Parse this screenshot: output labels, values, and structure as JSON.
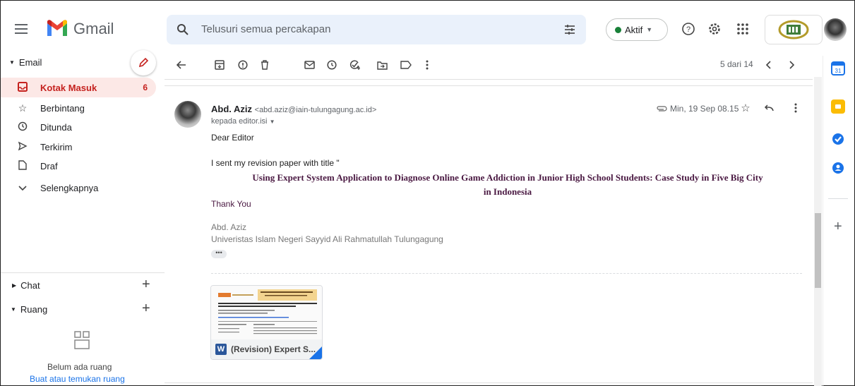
{
  "header": {
    "app_name": "Gmail",
    "search_placeholder": "Telusuri semua percakapan",
    "status": "Aktif"
  },
  "sidebar": {
    "email_header": "Email",
    "items": [
      {
        "label": "Kotak Masuk",
        "count": "6",
        "icon": "inbox-icon"
      },
      {
        "label": "Berbintang",
        "icon": "star-icon"
      },
      {
        "label": "Ditunda",
        "icon": "clock-icon"
      },
      {
        "label": "Terkirim",
        "icon": "send-icon"
      },
      {
        "label": "Draf",
        "icon": "draft-icon"
      },
      {
        "label": "Selengkapnya",
        "icon": "chevron-down-icon"
      }
    ],
    "chat_header": "Chat",
    "rooms_header": "Ruang",
    "no_rooms": "Belum ada ruang",
    "find_rooms_link": "Buat atau temukan ruang"
  },
  "toolbar": {
    "page_info": "5 dari 14"
  },
  "message": {
    "sender_name": "Abd. Aziz",
    "sender_email": "<abd.aziz@iain-tulungagung.ac.id>",
    "to_line": "kepada editor.isi",
    "date": "Min, 19 Sep 08.15",
    "greeting": "Dear Editor",
    "intro": "I sent my revision paper with title \"",
    "paper_title_line1": "Using Expert System Application to Diagnose Online Game Addiction in Junior High School Students: Case Study in Five Big City",
    "paper_title_line2": "in Indonesia",
    "thanks": "Thank You",
    "signature_name": "Abd. Aziz",
    "signature_org": "Univeristas Islam Negeri Sayyid Ali Rahmatullah Tulungagung",
    "ellipsis": "•••"
  },
  "attachment": {
    "name": "(Revision) Expert S...",
    "type_letter": "W"
  },
  "colors": {
    "active_nav_bg": "#fce8e6",
    "active_nav_text": "#c5221f",
    "search_bg": "#eaf1fb",
    "paper_title": "#4a1942"
  }
}
